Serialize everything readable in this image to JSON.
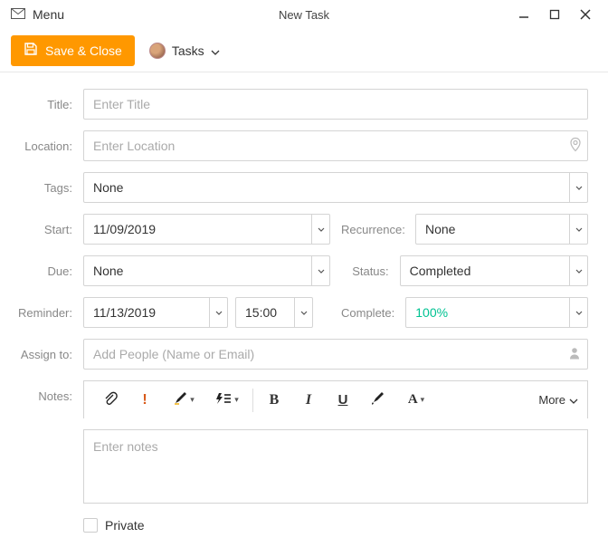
{
  "window": {
    "menu_label": "Menu",
    "title": "New Task"
  },
  "toolbar": {
    "save_close_label": "Save & Close",
    "tasks_label": "Tasks"
  },
  "labels": {
    "title": "Title:",
    "location": "Location:",
    "tags": "Tags:",
    "start": "Start:",
    "recurrence": "Recurrence:",
    "due": "Due:",
    "status": "Status:",
    "reminder": "Reminder:",
    "complete": "Complete:",
    "assign_to": "Assign to:",
    "notes": "Notes:",
    "private": "Private"
  },
  "fields": {
    "title_placeholder": "Enter Title",
    "location_placeholder": "Enter Location",
    "tags_value": "None",
    "start_value": "11/09/2019",
    "recurrence_value": "None",
    "due_value": "None",
    "status_value": "Completed",
    "reminder_date": "11/13/2019",
    "reminder_time": "15:00",
    "complete_value": "100%",
    "assign_placeholder": "Add People (Name or Email)",
    "notes_placeholder": "Enter notes"
  },
  "editor": {
    "more_label": "More"
  }
}
